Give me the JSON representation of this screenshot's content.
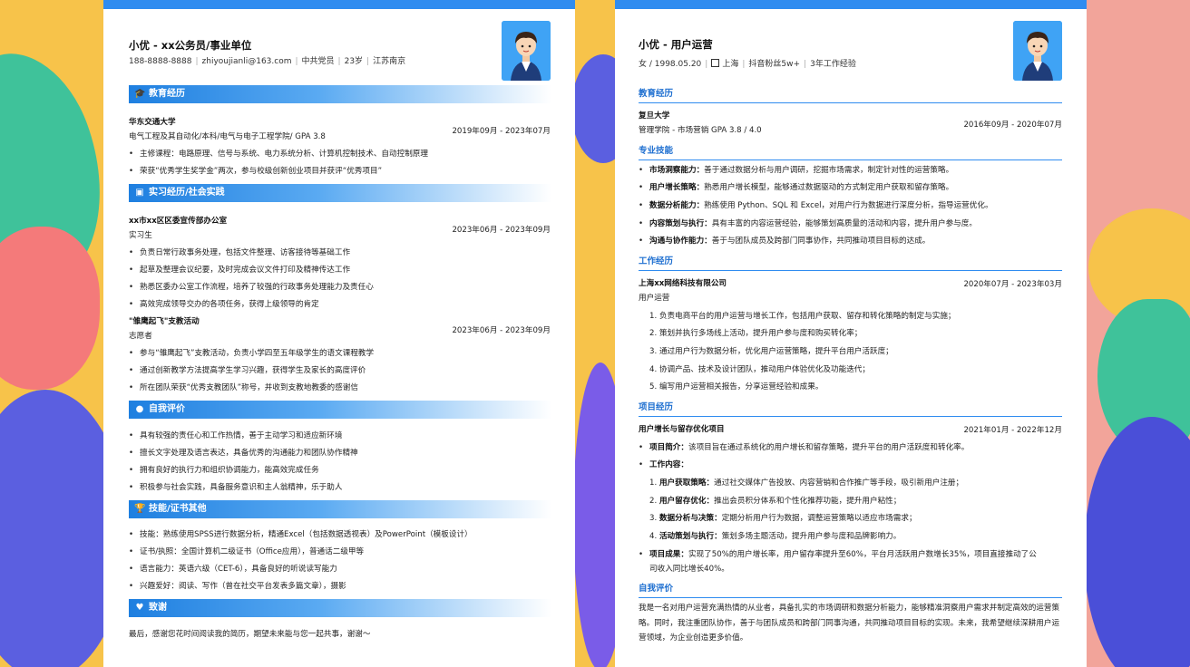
{
  "resume1": {
    "name": "小优 - xx公务员/事业单位",
    "info": [
      "188-8888-8888",
      "zhiyoujianli@163.com",
      "中共党员",
      "23岁",
      "江苏南京"
    ],
    "sections": {
      "education": "教育经历",
      "internship": "实习经历/社会实践",
      "self": "自我评价",
      "skills": "技能/证书其他",
      "thanks": "致谢"
    },
    "edu": {
      "school": "华东交通大学",
      "major": "电气工程及其自动化/本科/电气与电子工程学院/ GPA 3.8",
      "date": "2019年09月 - 2023年07月",
      "bullets": [
        "主修课程：电路原理、信号与系统、电力系统分析、计算机控制技术、自动控制原理",
        "荣获“优秀学生奖学金”两次，参与校级创新创业项目并获评“优秀项目”"
      ]
    },
    "exp1": {
      "org": "xx市xx区区委宣传部办公室",
      "date": "2023年06月 - 2023年09月",
      "role": "实习生",
      "bullets": [
        "负责日常行政事务处理，包括文件整理、访客接待等基础工作",
        "起草及整理会议纪要，及时完成会议文件打印及精神传达工作",
        "熟悉区委办公室工作流程，培养了较强的行政事务处理能力及责任心",
        "高效完成领导交办的各项任务，获得上级领导的肯定"
      ]
    },
    "exp2": {
      "org": "\"雏鹰起飞\"支教活动",
      "date": "2023年06月 - 2023年09月",
      "role": "志愿者",
      "bullets": [
        "参与“雏鹰起飞”支教活动，负责小学四至五年级学生的语文课程教学",
        "通过创新教学方法提高学生学习兴趣，获得学生及家长的高度评价",
        "所在团队荣获“优秀支教团队”称号，并收到支教地教委的感谢信"
      ]
    },
    "self": [
      "具有较强的责任心和工作热情，善于主动学习和适应新环境",
      "擅长文字处理及语言表达，具备优秀的沟通能力和团队协作精神",
      "拥有良好的执行力和组织协调能力，能高效完成任务",
      "积极参与社会实践，具备服务意识和主人翁精神，乐于助人"
    ],
    "skills": [
      "技能：熟练使用SPSS进行数据分析，精通Excel（包括数据透视表）及PowerPoint（模板设计）",
      "证书/执照：全国计算机二级证书（Office应用），普通话二级甲等",
      "语言能力：英语六级（CET-6），具备良好的听说读写能力",
      "兴趣爱好：阅读、写作（曾在社交平台发表多篇文章），摄影"
    ],
    "thanks": "最后，感谢您花时间阅读我的简历，期望未来能与您一起共事，谢谢～"
  },
  "resume2": {
    "name": "小优 - 用户运营",
    "info": [
      "女 / 1998.05.20",
      "上海",
      "抖音粉丝5w+",
      "3年工作经验"
    ],
    "sections": {
      "education": "教育经历",
      "skills": "专业技能",
      "work": "工作经历",
      "project": "项目经历",
      "self": "自我评价"
    },
    "edu": {
      "school": "复旦大学",
      "major": "管理学院 - 市场营销 GPA 3.8 / 4.0",
      "date": "2016年09月 - 2020年07月"
    },
    "skills": [
      {
        "k": "市场洞察能力：",
        "v": "善于通过数据分析与用户调研，挖掘市场需求，制定针对性的运营策略。"
      },
      {
        "k": "用户增长策略：",
        "v": "熟悉用户增长模型，能够通过数据驱动的方式制定用户获取和留存策略。"
      },
      {
        "k": "数据分析能力：",
        "v": "熟练使用 Python、SQL 和 Excel，对用户行为数据进行深度分析，指导运营优化。"
      },
      {
        "k": "内容策划与执行：",
        "v": "具有丰富的内容运营经验，能够策划高质量的活动和内容，提升用户参与度。"
      },
      {
        "k": "沟通与协作能力：",
        "v": "善于与团队成员及跨部门同事协作，共同推动项目目标的达成。"
      }
    ],
    "work": {
      "company": "上海xx网络科技有限公司",
      "date": "2020年07月 - 2023年03月",
      "role": "用户运营",
      "items": [
        "负责电商平台的用户运营与增长工作，包括用户获取、留存和转化策略的制定与实施；",
        "策划并执行多场线上活动，提升用户参与度和购买转化率；",
        "通过用户行为数据分析，优化用户运营策略，提升平台用户活跃度；",
        "协调产品、技术及设计团队，推动用户体验优化及功能迭代；",
        "编写用户运营相关报告，分享运营经验和成果。"
      ]
    },
    "project": {
      "name": "用户增长与留存优化项目",
      "date": "2021年01月 - 2022年12月",
      "intro_k": "项目简介：",
      "intro_v": "该项目旨在通过系统化的用户增长和留存策略，提升平台的用户活跃度和转化率。",
      "content_k": "工作内容：",
      "items": [
        {
          "k": "用户获取策略：",
          "v": "通过社交媒体广告投放、内容营销和合作推广等手段，吸引新用户注册；"
        },
        {
          "k": "用户留存优化：",
          "v": "推出会员积分体系和个性化推荐功能，提升用户粘性；"
        },
        {
          "k": "数据分析与决策：",
          "v": "定期分析用户行为数据，调整运营策略以适应市场需求；"
        },
        {
          "k": "活动策划与执行：",
          "v": "策划多场主题活动，提升用户参与度和品牌影响力。"
        }
      ],
      "result_k": "项目成果：",
      "result_v1": "实现了50%的用户增长率，用户留存率提升至60%，平台月活跃用户数增长35%，项目直接推动了公",
      "result_v2": "司收入同比增长40%。"
    },
    "self": "我是一名对用户运营充满热情的从业者，具备扎实的市场调研和数据分析能力，能够精准洞察用户需求并制定高效的运营策略。同时，我注重团队协作，善于与团队成员和跨部门同事沟通，共同推动项目目标的实现。未来，我希望继续深耕用户运营领域，为企业创造更多价值。"
  },
  "colors": {
    "accent": "#2f8cf0",
    "heading": "#1e6fd0"
  },
  "icons": [
    "graduation-cap-icon",
    "briefcase-icon",
    "user-icon",
    "trophy-icon",
    "heart-icon",
    "building-icon"
  ]
}
